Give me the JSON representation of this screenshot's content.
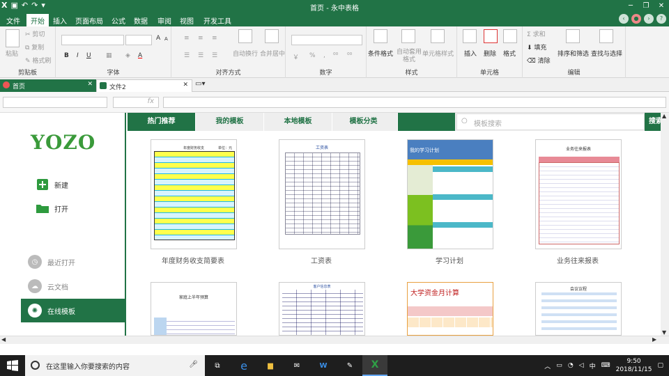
{
  "app": {
    "title": "首页 - 永中表格"
  },
  "menu": {
    "items": [
      "文件",
      "开始",
      "插入",
      "页面布局",
      "公式",
      "数据",
      "审阅",
      "视图",
      "开发工具"
    ]
  },
  "ribbon": {
    "clipboard": {
      "label": "剪贴板",
      "paste": "粘贴",
      "cut": "剪切",
      "copy": "复制",
      "format_painter": "格式刷"
    },
    "font": {
      "label": "字体",
      "bold": "B",
      "italic": "I",
      "underline": "U",
      "grow": "A",
      "shrink": "A"
    },
    "alignment": {
      "label": "对齐方式",
      "wrap": "自动换行",
      "merge": "合并居中"
    },
    "number": {
      "label": "数字",
      "currency": "￥",
      "percent": "%"
    },
    "styles": {
      "label": "样式",
      "conditional": "条件格式",
      "apply_table": "自动套用格式",
      "cell_style": "单元格样式"
    },
    "cells": {
      "label": "单元格",
      "insert": "插入",
      "delete": "删除",
      "format": "格式"
    },
    "editing": {
      "label": "编辑",
      "sum": "求和",
      "fill": "填充",
      "clear": "清除",
      "sort": "排序和筛选",
      "find": "查找与选择"
    }
  },
  "doc_tabs": [
    {
      "label": "首页"
    },
    {
      "label": "文件2"
    }
  ],
  "formula": {
    "fx": "fx"
  },
  "sidebar": {
    "logo": "YOZO",
    "new": "新建",
    "open": "打开",
    "recent": "最近打开",
    "cloud": "云文档",
    "online": "在线模板"
  },
  "content": {
    "tabs": [
      "热门推荐",
      "我的模板",
      "本地模板",
      "模板分类"
    ],
    "search_placeholder": "模板搜索",
    "search_button": "搜索",
    "templates": [
      {
        "name": "年度财务收支简要表",
        "thumb_title": "年度财务收支",
        "thumb_sub": "单位：元"
      },
      {
        "name": "工资表",
        "thumb_title": "工资表"
      },
      {
        "name": "学习计划",
        "thumb_title": "我的学习计划"
      },
      {
        "name": "业务往来报表",
        "thumb_title": "业务往来报表"
      },
      {
        "name": "",
        "thumb_title": "家庭上半年预算"
      },
      {
        "name": "",
        "thumb_title": "客户信息表"
      },
      {
        "name": "",
        "thumb_title": "大学资金月计算"
      },
      {
        "name": "",
        "thumb_title": "会议议程"
      }
    ]
  },
  "taskbar": {
    "search_placeholder": "在这里输入你要搜索的内容",
    "time": "9:50",
    "date": "2018/11/15",
    "ime": "中"
  },
  "colors": {
    "brand": "#217346"
  }
}
